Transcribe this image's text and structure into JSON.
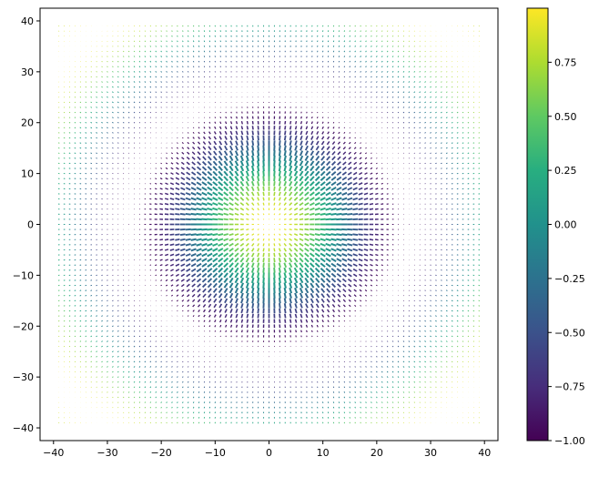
{
  "chart_data": {
    "type": "quiver",
    "title": "",
    "xlabel": "",
    "ylabel": "",
    "xlim": [
      -42.5,
      42.5
    ],
    "ylim": [
      -42.5,
      42.5
    ],
    "xticks": [
      -40,
      -30,
      -20,
      -10,
      0,
      10,
      20,
      30,
      40
    ],
    "yticks": [
      -40,
      -30,
      -20,
      -10,
      0,
      10,
      20,
      30,
      40
    ],
    "grid": {
      "x": [
        -39,
        39
      ],
      "y": [
        -39,
        39
      ],
      "step": 1
    },
    "field": {
      "description_of_color": "cos(r / 8) where r is distance from origin",
      "direction": "radially outward, arrow length grows with |color| near mid radius",
      "color_scale_min": -1.0,
      "color_scale_max": 1.0
    },
    "colorbar": {
      "colormap": "viridis",
      "range": [
        -1.0,
        1.0
      ],
      "ticks": [
        -1.0,
        -0.75,
        -0.5,
        -0.25,
        0.0,
        0.25,
        0.5,
        0.75
      ],
      "tick_labels": [
        "−1.00",
        "−0.75",
        "−0.50",
        "−0.25",
        "0.00",
        "0.25",
        "0.50",
        "0.75"
      ]
    },
    "grid_lines": false,
    "legend": "none"
  },
  "axis_labels": {
    "x": [
      "−40",
      "−30",
      "−20",
      "−10",
      "0",
      "10",
      "20",
      "30",
      "40"
    ],
    "y": [
      "40",
      "30",
      "20",
      "10",
      "0",
      "−10",
      "−20",
      "−30",
      "−40"
    ]
  }
}
